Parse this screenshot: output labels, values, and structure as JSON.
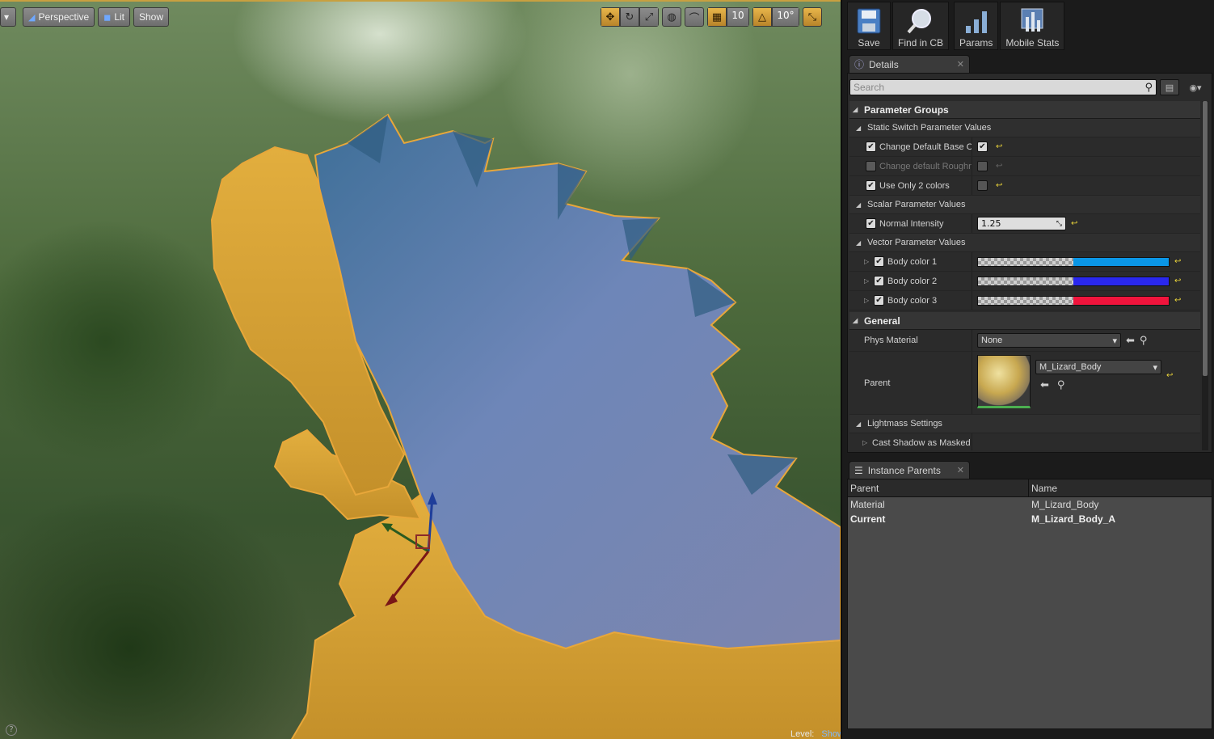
{
  "viewport": {
    "menu_arrow": "▾",
    "buttons": {
      "perspective": "Perspective",
      "lit": "Lit",
      "show": "Show"
    },
    "grid_snap": "10",
    "rotation_snap": "10°",
    "level_label": "Level:",
    "level_value": "Showcase (Persistent)",
    "help": "?"
  },
  "toolbar": {
    "save": "Save",
    "find_in_cb": "Find in CB",
    "params": "Params",
    "mobile_stats": "Mobile Stats"
  },
  "details": {
    "tab_label": "Details",
    "search_placeholder": "Search",
    "parameter_groups": "Parameter Groups",
    "static_switch": {
      "label": "Static Switch Parameter Values",
      "items": [
        {
          "name": "Change Default Base Color",
          "override": true,
          "value": true
        },
        {
          "name": "Change default Roughness",
          "override": false,
          "value": false
        },
        {
          "name": "Use Only 2 colors",
          "override": true,
          "value": false
        }
      ]
    },
    "scalar": {
      "label": "Scalar Parameter Values",
      "normal_intensity_label": "Normal Intensity",
      "normal_intensity_value": "1.25"
    },
    "vector": {
      "label": "Vector Parameter Values",
      "items": [
        {
          "name": "Body color 1",
          "color": "#0a96e6"
        },
        {
          "name": "Body color 2",
          "color": "#2a28ee"
        },
        {
          "name": "Body color 3",
          "color": "#f0143c"
        }
      ]
    },
    "general": {
      "label": "General",
      "phys_material_label": "Phys Material",
      "phys_material_value": "None",
      "parent_label": "Parent",
      "parent_value": "M_Lizard_Body"
    },
    "lightmass": {
      "label": "Lightmass Settings",
      "cast_shadow": "Cast Shadow as Masked"
    }
  },
  "instance_parents": {
    "tab_label": "Instance Parents",
    "col_parent": "Parent",
    "col_name": "Name",
    "rows": [
      {
        "parent": "Material",
        "name": "M_Lizard_Body"
      },
      {
        "parent": "Current",
        "name": "M_Lizard_Body_A"
      }
    ]
  }
}
